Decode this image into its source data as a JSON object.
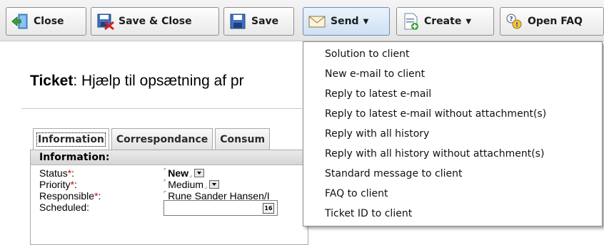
{
  "toolbar": {
    "close_label": "Close",
    "save_close_label": "Save & Close",
    "save_label": "Save",
    "send_label": "Send",
    "create_label": "Create",
    "open_faq_label": "Open FAQ"
  },
  "ticket": {
    "label": "Ticket",
    "title": "Hjælp til opsætning af pr"
  },
  "tabs": [
    {
      "label": "Information"
    },
    {
      "label": "Correspondance"
    },
    {
      "label": "Consum"
    }
  ],
  "panel": {
    "header": "Information:",
    "fields": {
      "status": {
        "label": "Status",
        "required_mark": "*",
        "colon": ":",
        "value": "New"
      },
      "priority": {
        "label": "Priority",
        "required_mark": "*",
        "colon": ":",
        "value": "Medium"
      },
      "responsible": {
        "label": "Responsible",
        "required_mark": "*",
        "colon": ":",
        "value": "Rune Sander Hansen/I"
      },
      "scheduled": {
        "label": "Scheduled:",
        "calendar_day": "16"
      }
    }
  },
  "send_menu": {
    "items": [
      "Solution to client",
      "New e-mail to client",
      "Reply to latest e-mail",
      "Reply to latest e-mail without attachment(s)",
      "Reply with all history",
      "Reply with all history without attachment(s)",
      "Standard message to client",
      "FAQ to client",
      "Ticket ID to client"
    ]
  },
  "icons": {
    "close": "door-exit-icon",
    "save_close": "save-close-icon",
    "save": "floppy-disk-icon",
    "send": "envelope-icon",
    "create": "new-document-icon",
    "open_faq": "faq-question-icon"
  },
  "colors": {
    "required": "#d10000",
    "toolbar_bg": "#e9e9e9",
    "active_button": "#cfe1f3"
  }
}
